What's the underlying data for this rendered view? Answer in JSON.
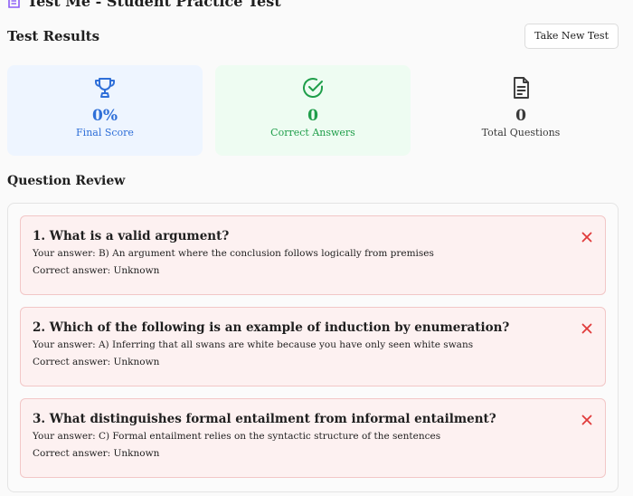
{
  "app": {
    "title": "Test Me - Student Practice Test"
  },
  "results": {
    "title": "Test Results",
    "new_test_label": "Take New Test"
  },
  "stats": [
    {
      "value": "0%",
      "label": "Final Score",
      "icon": "trophy-icon"
    },
    {
      "value": "0",
      "label": "Correct Answers",
      "icon": "check-circle-icon"
    },
    {
      "value": "0",
      "label": "Total Questions",
      "icon": "document-icon"
    }
  ],
  "review": {
    "title": "Question Review",
    "questions": [
      {
        "title": "1. What is a valid argument?",
        "your_answer": "Your answer: B) An argument where the conclusion follows logically from premises",
        "correct_answer": "Correct answer: Unknown"
      },
      {
        "title": "2. Which of the following is an example of induction by enumeration?",
        "your_answer": "Your answer: A) Inferring that all swans are white because you have only seen white swans",
        "correct_answer": "Correct answer: Unknown"
      },
      {
        "title": "3. What distinguishes formal entailment from informal entailment?",
        "your_answer": "Your answer: C) Formal entailment relies on the syntactic structure of the sentences",
        "correct_answer": "Correct answer: Unknown"
      }
    ]
  },
  "colors": {
    "score": "#2f6fd8",
    "correct": "#1f9e4a",
    "incorrect": "#e03b3b",
    "accent_header": "#8b5cf6"
  }
}
